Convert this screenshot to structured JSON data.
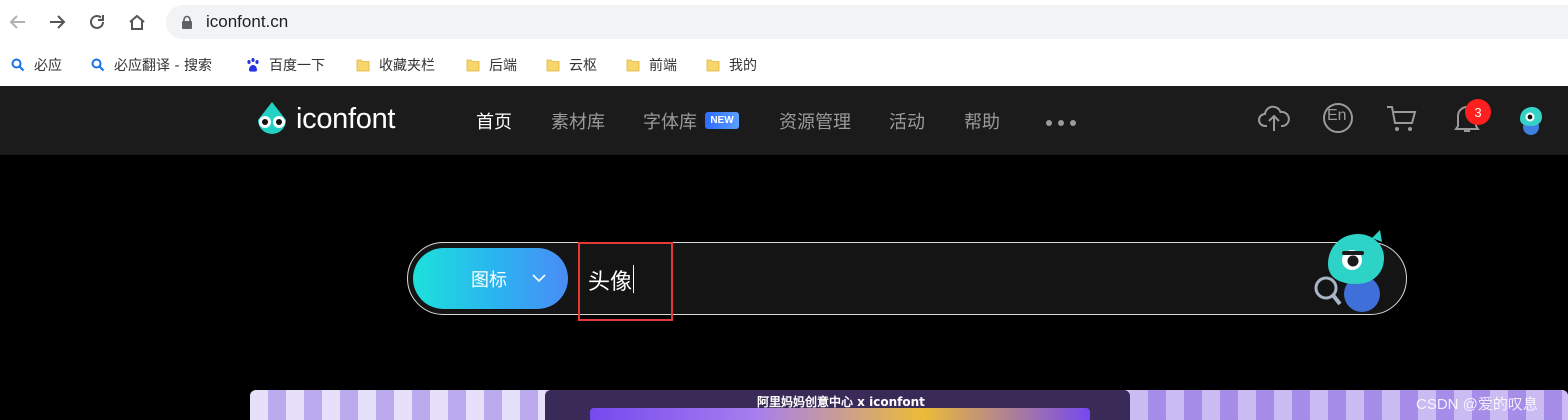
{
  "browser": {
    "url": "iconfont.cn",
    "bookmarks": [
      {
        "label": "必应",
        "icon": "search-icon"
      },
      {
        "label": "必应翻译 - 搜索",
        "icon": "search-icon"
      },
      {
        "label": "百度一下",
        "icon": "baidu-paw-icon"
      },
      {
        "label": "收藏夹栏",
        "icon": "folder-icon"
      },
      {
        "label": "后端",
        "icon": "folder-icon"
      },
      {
        "label": "云枢",
        "icon": "folder-icon"
      },
      {
        "label": "前端",
        "icon": "folder-icon"
      },
      {
        "label": "我的",
        "icon": "folder-icon"
      }
    ]
  },
  "header": {
    "logo_text": "iconfont",
    "menu": [
      {
        "label": "首页",
        "active": true
      },
      {
        "label": "素材库",
        "active": false
      },
      {
        "label": "字体库",
        "active": false
      },
      {
        "label": "资源管理",
        "active": false
      },
      {
        "label": "活动",
        "active": false
      },
      {
        "label": "帮助",
        "active": false
      }
    ],
    "new_badge": "NEW",
    "notification_count": "3",
    "language_label": "En"
  },
  "search": {
    "type_label": "图标",
    "query": "头像"
  },
  "banner": {
    "title": "阿里妈妈创意中心 x iconfont"
  },
  "watermark": "CSDN @爱的叹息",
  "colors": {
    "header_bg": "#1b1b1b",
    "accent_start": "#1de1dc",
    "accent_end": "#4a8cf5",
    "highlight_red": "#e53935",
    "badge_red": "#ff1f1f"
  }
}
